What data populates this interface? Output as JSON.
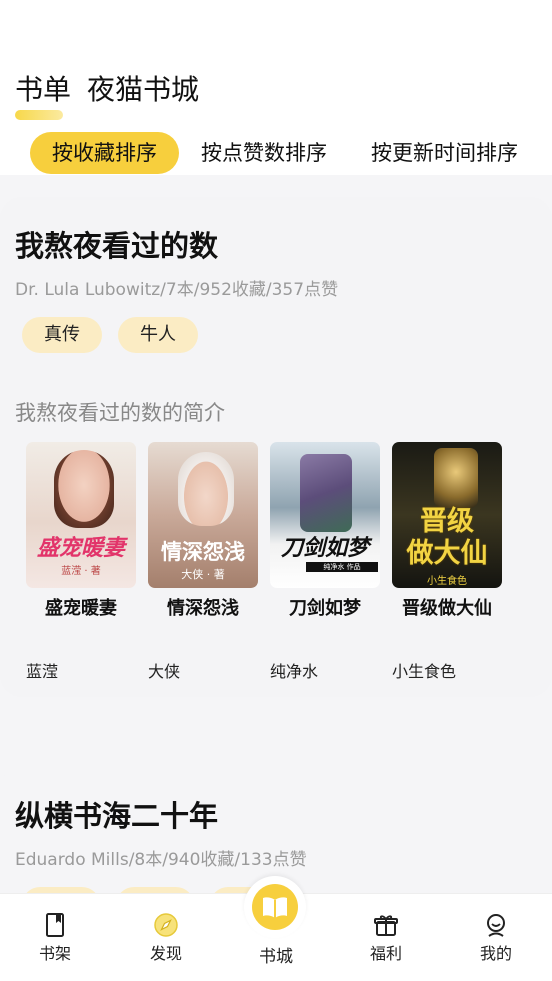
{
  "top_tabs": [
    "书单",
    "夜猫书城"
  ],
  "sort_options": [
    "按收藏排序",
    "按点赞数排序",
    "按更新时间排序"
  ],
  "cards": [
    {
      "title": "我熬夜看过的数",
      "meta": "Dr. Lula Lubowitz/7本/952收藏/357点赞",
      "tags": [
        "真传",
        "牛人"
      ],
      "intro": "我熬夜看过的数的简介",
      "books": [
        {
          "name": "盛宠暖妻",
          "author": "蓝滢",
          "cover_title": "盛宠暖妻",
          "cover_author": "蓝滢 · 著"
        },
        {
          "name": "情深怨浅",
          "author": "大侠",
          "cover_title": "情深怨浅",
          "cover_author": "大侠 · 著"
        },
        {
          "name": "刀剑如梦",
          "author": "纯净水",
          "cover_title": "刀剑如梦",
          "cover_author": "纯净水 作品"
        },
        {
          "name": "晋级做大仙",
          "author": "小生食色",
          "cover_title": "晋级\n做大仙",
          "cover_author": "小生食色"
        }
      ]
    },
    {
      "title": "纵横书海二十年",
      "meta": "Eduardo Mills/8本/940收藏/133点赞"
    }
  ],
  "bottom_nav": {
    "shelf": "书架",
    "discover": "发现",
    "store": "书城",
    "welfare": "福利",
    "mine": "我的"
  },
  "colors": {
    "accent": "#f7cf3d",
    "tag_bg": "#fbecc4",
    "content_bg": "#f5f5f7"
  }
}
